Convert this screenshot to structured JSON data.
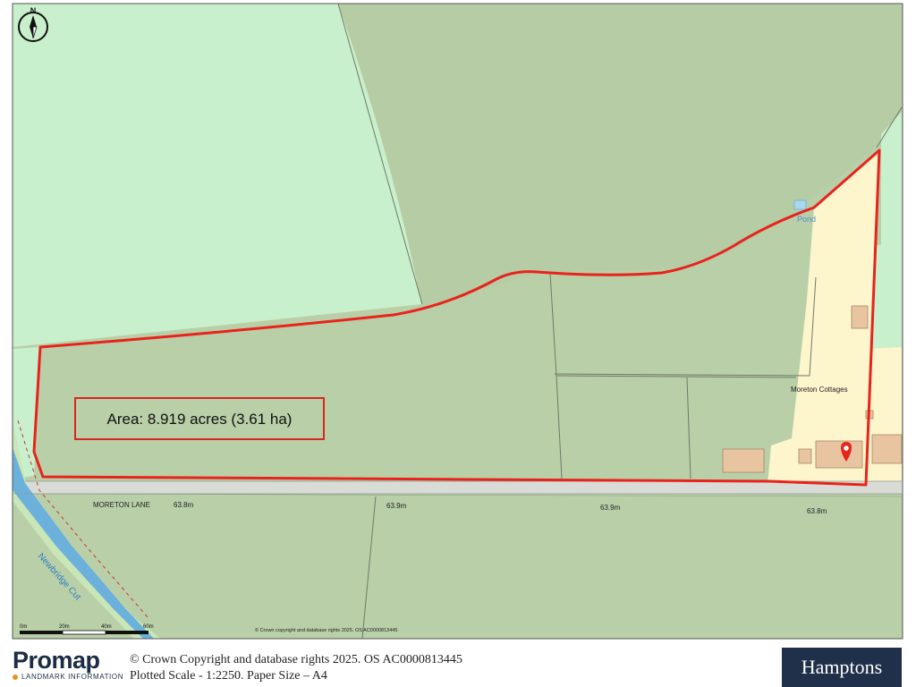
{
  "map": {
    "north_label": "N",
    "area_text": "Area: 8.919 acres (3.61 ha)",
    "labels": {
      "pond": "Pond",
      "moreton_cottages": "Moreton Cottages",
      "moreton_lane": "MORETON LANE",
      "elev_1": "63.8m",
      "elev_2": "63.9m",
      "elev_3": "63.9m",
      "elev_4": "63.8m",
      "newbridge_cut": "Newbridge Cut",
      "map_copyright": "© Crown copyright and database rights 2025. OS AC0000813445"
    },
    "scale_bar": {
      "ticks": [
        "0m",
        "20m",
        "40m",
        "60m"
      ]
    },
    "colors": {
      "boundary": "#e8231c",
      "field": "#b9cfa8",
      "light_field": "#c9f0cc",
      "residential": "#fdf5cc",
      "road": "#d9dcd6",
      "water": "#6bb1dc"
    }
  },
  "footer": {
    "promap_name": "Promap",
    "promap_tagline": "LANDMARK INFORMATION",
    "copyright": "© Crown Copyright and database rights 2025. OS AC0000813445",
    "scale": "Plotted Scale - 1:2250. Paper Size – A4",
    "agent_brand": "Hamptons"
  }
}
